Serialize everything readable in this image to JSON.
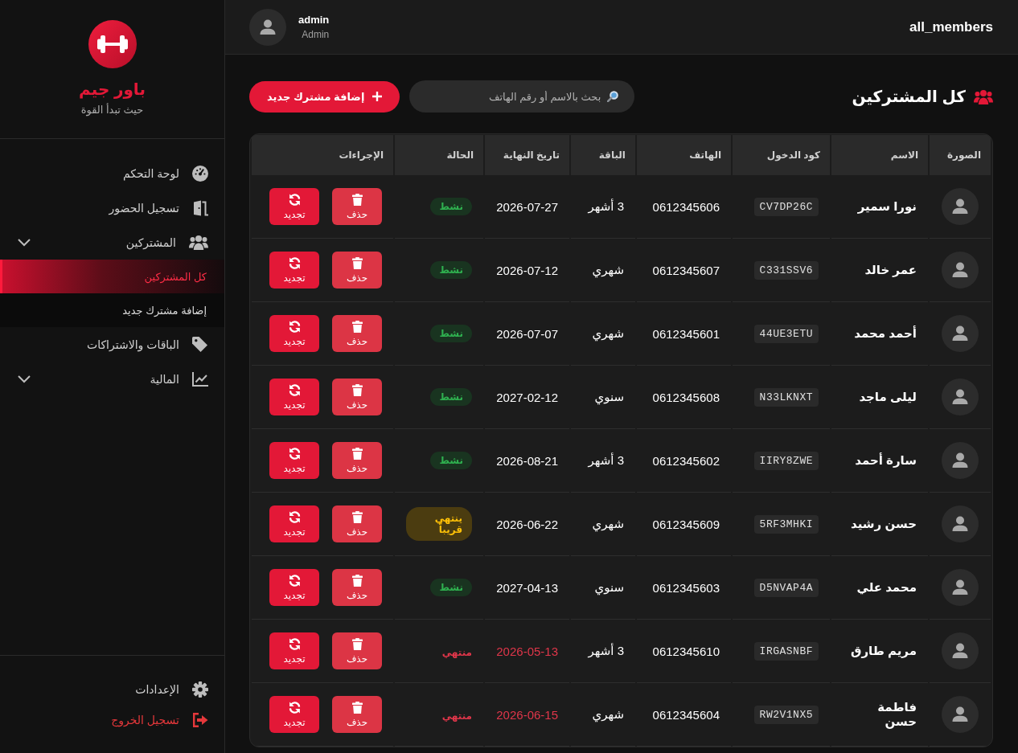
{
  "sidebar": {
    "brand": {
      "name": "باور جيم",
      "tagline": "حيث تبدأ القوة"
    },
    "menu": [
      {
        "label": "لوحة التحكم",
        "kind": "link",
        "selected": false
      },
      {
        "label": "تسجيل الحضور",
        "kind": "link",
        "selected": false
      },
      {
        "label": "المشتركين",
        "kind": "group",
        "selected": false,
        "expanded": true,
        "children": [
          {
            "label": "كل المشتركين",
            "selected": true
          },
          {
            "label": "إضافة مشترك جديد",
            "selected": false
          }
        ]
      },
      {
        "label": "الباقات والاشتراكات",
        "kind": "link",
        "selected": false
      },
      {
        "label": "المالية",
        "kind": "group",
        "selected": false
      }
    ],
    "footer": [
      {
        "label": "الإعدادات",
        "kind": "settings"
      },
      {
        "label": "تسجيل الخروج",
        "kind": "logout"
      }
    ]
  },
  "header": {
    "user": {
      "name": "admin",
      "role": "Admin"
    },
    "page_key": "all_members"
  },
  "content": {
    "title": "كل المشتركين",
    "search": {
      "placeholder": "بحث بالاسم أو رقم الهاتف"
    },
    "add_button": "إضافة مشترك جديد"
  },
  "table": {
    "columns": [
      "الصورة",
      "الاسم",
      "كود الدخول",
      "الهاتف",
      "الباقة",
      "تاريخ النهاية",
      "الحالة",
      "الإجراءات"
    ],
    "rows": [
      {
        "name": "نورا سمير",
        "code": "CV7DP26C",
        "phone": "0612345606",
        "plan": "3 أشهر",
        "end_date": "2026-07-27",
        "status": {
          "label": "نشط",
          "kind": "active"
        },
        "actions": [
          {
            "label": "حذف",
            "kind": "delete"
          },
          {
            "label": "تجديد",
            "kind": "renew"
          }
        ]
      },
      {
        "name": "عمر خالد",
        "code": "C331SSV6",
        "phone": "0612345607",
        "plan": "شهري",
        "end_date": "2026-07-12",
        "status": {
          "label": "نشط",
          "kind": "active"
        },
        "actions": [
          {
            "label": "حذف",
            "kind": "delete"
          },
          {
            "label": "تجديد",
            "kind": "renew"
          }
        ]
      },
      {
        "name": "أحمد محمد",
        "code": "44UE3ETU",
        "phone": "0612345601",
        "plan": "شهري",
        "end_date": "2026-07-07",
        "status": {
          "label": "نشط",
          "kind": "active"
        },
        "actions": [
          {
            "label": "حذف",
            "kind": "delete"
          },
          {
            "label": "تجديد",
            "kind": "renew"
          }
        ]
      },
      {
        "name": "ليلى ماجد",
        "code": "N33LKNXT",
        "phone": "0612345608",
        "plan": "سنوي",
        "end_date": "2027-02-12",
        "status": {
          "label": "نشط",
          "kind": "active"
        },
        "actions": [
          {
            "label": "حذف",
            "kind": "delete"
          },
          {
            "label": "تجديد",
            "kind": "renew"
          }
        ]
      },
      {
        "name": "سارة أحمد",
        "code": "IIRY8ZWE",
        "phone": "0612345602",
        "plan": "3 أشهر",
        "end_date": "2026-08-21",
        "status": {
          "label": "نشط",
          "kind": "active"
        },
        "actions": [
          {
            "label": "حذف",
            "kind": "delete"
          },
          {
            "label": "تجديد",
            "kind": "renew"
          }
        ]
      },
      {
        "name": "حسن رشيد",
        "code": "5RF3MHKI",
        "phone": "0612345609",
        "plan": "شهري",
        "end_date": "2026-06-22",
        "status": {
          "label": "ينتهي قريباً",
          "kind": "expiring"
        },
        "actions": [
          {
            "label": "حذف",
            "kind": "delete"
          },
          {
            "label": "تجديد",
            "kind": "renew"
          }
        ]
      },
      {
        "name": "محمد علي",
        "code": "D5NVAP4A",
        "phone": "0612345603",
        "plan": "سنوي",
        "end_date": "2027-04-13",
        "status": {
          "label": "نشط",
          "kind": "active"
        },
        "actions": [
          {
            "label": "حذف",
            "kind": "delete"
          },
          {
            "label": "تجديد",
            "kind": "renew"
          }
        ]
      },
      {
        "name": "مريم طارق",
        "code": "IRGASNBF",
        "phone": "0612345610",
        "plan": "3 أشهر",
        "end_date": "2026-05-13",
        "status": {
          "label": "منتهي",
          "kind": "expired"
        },
        "actions": [
          {
            "label": "حذف",
            "kind": "delete"
          },
          {
            "label": "تجديد",
            "kind": "renew"
          }
        ]
      },
      {
        "name": "فاطمة حسن",
        "code": "RW2V1NX5",
        "phone": "0612345604",
        "plan": "شهري",
        "end_date": "2026-06-15",
        "status": {
          "label": "منتهي",
          "kind": "expired"
        },
        "actions": [
          {
            "label": "حذف",
            "kind": "delete"
          },
          {
            "label": "تجديد",
            "kind": "renew"
          }
        ]
      }
    ]
  }
}
